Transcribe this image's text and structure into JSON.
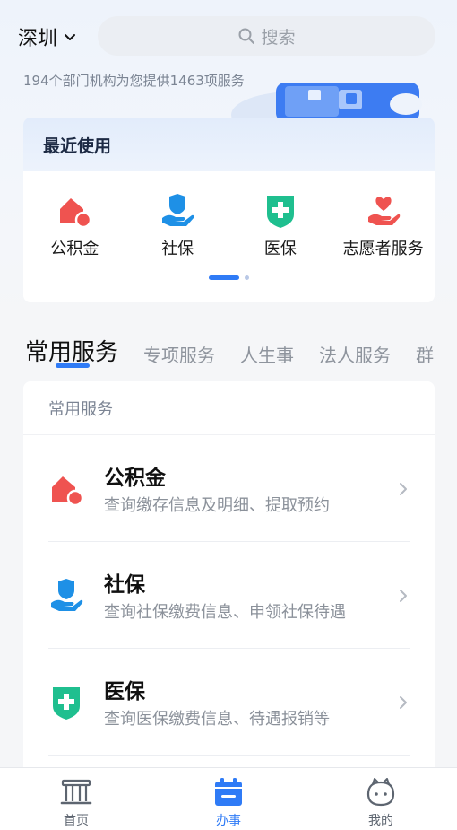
{
  "header": {
    "city": "深圳",
    "search_placeholder": "搜索"
  },
  "banner": {
    "text": "194个部门机构为您提供1463项服务"
  },
  "recent": {
    "title": "最近使用",
    "items": [
      {
        "label": "公积金",
        "icon": "house-fund-icon"
      },
      {
        "label": "社保",
        "icon": "social-security-icon"
      },
      {
        "label": "医保",
        "icon": "medical-insurance-icon"
      },
      {
        "label": "志愿者服务",
        "icon": "volunteer-heart-icon"
      }
    ],
    "page_indicator": {
      "pages": 2,
      "current": 1
    }
  },
  "tabs": [
    {
      "label": "常用服务",
      "active": true
    },
    {
      "label": "专项服务",
      "active": false
    },
    {
      "label": "人生事",
      "active": false
    },
    {
      "label": "法人服务",
      "active": false
    },
    {
      "label": "群",
      "active": false
    }
  ],
  "service_list": {
    "title": "常用服务",
    "items": [
      {
        "name": "公积金",
        "desc": "查询缴存信息及明细、提取预约",
        "icon": "house-fund-icon"
      },
      {
        "name": "社保",
        "desc": "查询社保缴费信息、申领社保待遇",
        "icon": "social-security-icon"
      },
      {
        "name": "医保",
        "desc": "查询医保缴费信息、待遇报销等",
        "icon": "medical-insurance-icon"
      }
    ]
  },
  "bottom_nav": [
    {
      "label": "首页",
      "icon": "home-building-icon",
      "active": false
    },
    {
      "label": "办事",
      "icon": "calendar-icon",
      "active": true
    },
    {
      "label": "我的",
      "icon": "profile-face-icon",
      "active": false
    }
  ],
  "colors": {
    "accent": "#2f7bf6",
    "fund_red": "#ef5350",
    "social_blue": "#1e90e6",
    "medical_green": "#1fbf8f",
    "volunteer_red": "#ef5350"
  }
}
